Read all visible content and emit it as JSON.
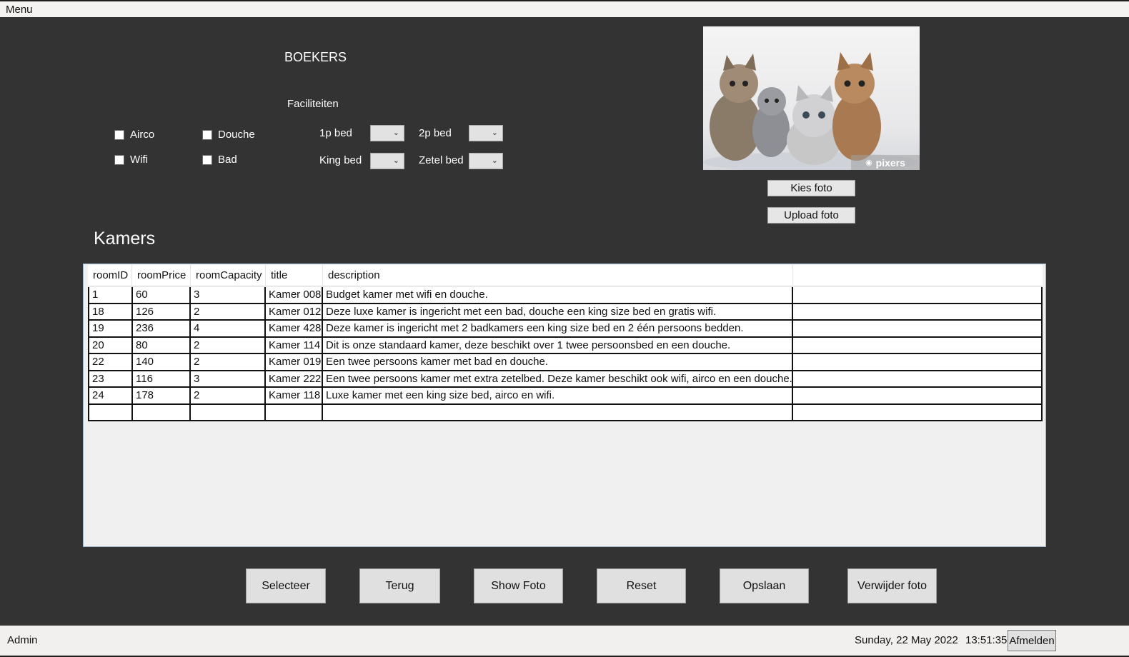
{
  "menubar": {
    "menu_label": "Menu"
  },
  "form": {
    "title": "BOEKERS",
    "facilities_title": "Faciliteiten",
    "checkboxes": [
      {
        "label": "Airco",
        "checked": false
      },
      {
        "label": "Douche",
        "checked": false
      },
      {
        "label": "Wifi",
        "checked": false
      },
      {
        "label": "Bad",
        "checked": false
      }
    ],
    "beds": [
      {
        "label": "1p bed",
        "value": ""
      },
      {
        "label": "2p bed",
        "value": ""
      },
      {
        "label": "King bed",
        "value": ""
      },
      {
        "label": "Zetel bed",
        "value": ""
      }
    ]
  },
  "photo": {
    "watermark": "pixers",
    "choose_label": "Kies foto",
    "upload_label": "Upload foto"
  },
  "rooms": {
    "heading": "Kamers",
    "columns": [
      "roomID",
      "roomPrice",
      "roomCapacity",
      "title",
      "description"
    ],
    "rows": [
      [
        "1",
        "60",
        "3",
        "Kamer 008",
        "Budget kamer met wifi en douche."
      ],
      [
        "18",
        "126",
        "2",
        "Kamer 012",
        "Deze luxe kamer is ingericht met een bad, douche een king size bed en gratis wifi."
      ],
      [
        "19",
        "236",
        "4",
        "Kamer 428",
        "Deze kamer is ingericht met 2 badkamers een king size bed en 2 één persoons bedden."
      ],
      [
        "20",
        "80",
        "2",
        "Kamer 114",
        "Dit is onze standaard kamer, deze beschikt over 1 twee persoonsbed en een douche."
      ],
      [
        "22",
        "140",
        "2",
        "Kamer 019",
        "Een twee persoons kamer met bad en douche."
      ],
      [
        "23",
        "116",
        "3",
        "Kamer 222",
        "Een twee persoons kamer met extra zetelbed. Deze kamer beschikt ook wifi, airco en een douche."
      ],
      [
        "24",
        "178",
        "2",
        "Kamer 118",
        "Luxe kamer met een king size bed, airco en wifi."
      ],
      [
        "",
        "",
        "",
        "",
        ""
      ]
    ]
  },
  "actions": {
    "select": "Selecteer",
    "back": "Terug",
    "show_photo": "Show Foto",
    "reset": "Reset",
    "save": "Opslaan",
    "delete_photo": "Verwijder foto"
  },
  "status": {
    "user": "Admin",
    "date": "Sunday, 22 May 2022",
    "time": "13:51:35",
    "logout": "Afmelden"
  }
}
